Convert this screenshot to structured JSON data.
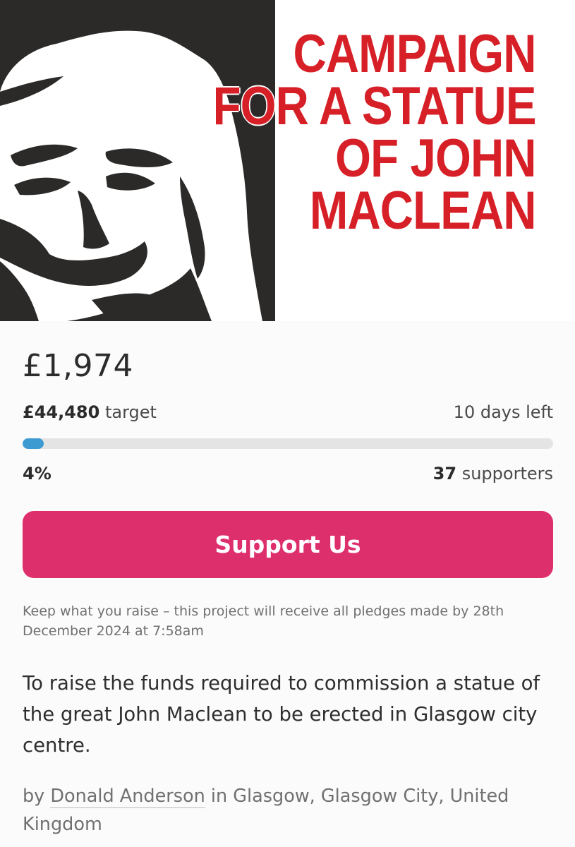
{
  "hero": {
    "title_lines": [
      "CAMPAIGN",
      "FOR A STATUE",
      "OF JOHN",
      "MACLEAN"
    ],
    "title_color": "#d61f26"
  },
  "funding": {
    "raised": "£1,974",
    "target_amount": "£44,480",
    "target_suffix": "target",
    "days_left": "10 days left",
    "percent": "4%",
    "progress_fraction": 0.04,
    "supporters_count": "37",
    "supporters_suffix": "supporters",
    "progress_color": "#3e9bd1"
  },
  "cta": {
    "support_label": "Support Us",
    "color": "#de2f6d"
  },
  "note": "Keep what you raise – this project will receive all pledges made by 28th December 2024 at 7:58am",
  "description": "To raise the funds required to commission a statue of the great John Maclean to be erected in Glasgow city centre.",
  "byline": {
    "prefix": "by",
    "author": "Donald Anderson",
    "location": "in Glasgow, Glasgow City, United Kingdom"
  }
}
